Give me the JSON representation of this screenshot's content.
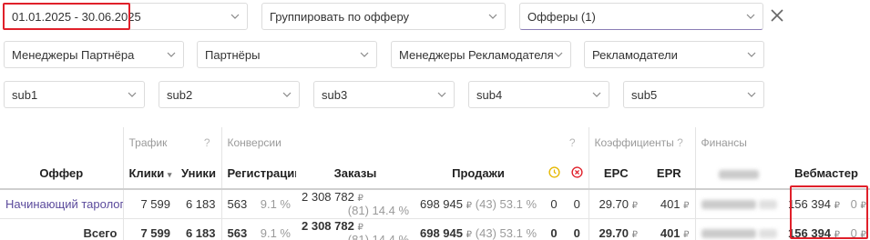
{
  "filters": {
    "date_range": "01.01.2025 - 30.06.2025",
    "group_by": "Группировать по офферу",
    "offers": "Офферы (1)",
    "partner_managers": "Менеджеры Партнёра",
    "partners": "Партнёры",
    "advertiser_managers": "Менеджеры Рекламодателя",
    "advertisers": "Рекламодатели",
    "sub1": "sub1",
    "sub2": "sub2",
    "sub3": "sub3",
    "sub4": "sub4",
    "sub5": "sub5"
  },
  "sections": {
    "traffic": "Трафик",
    "traffic_help": "?",
    "conversions": "Конверсии",
    "conversions_help": "?",
    "coefficients": "Коэффициенты",
    "coefficients_help": "?",
    "finances": "Финансы"
  },
  "columns": {
    "offer": "Оффер",
    "clicks": "Клики",
    "clicks_sort": "▾",
    "uniques": "Уники",
    "registrations": "Регистрации",
    "orders": "Заказы",
    "sales": "Продажи",
    "epc": "EPC",
    "epr": "EPR",
    "webmaster": "Вебмастер"
  },
  "rows": [
    {
      "offer": "Начинающий таролог",
      "clicks": "7 599",
      "uniques": "6 183",
      "registrations": "563",
      "reg_pct": "9.1 %",
      "orders_sum": "2 308 782",
      "orders_detail": "(81) 14.4 %",
      "sales_sum": "698 945",
      "sales_detail": "(43) 53.1 %",
      "pending": "0",
      "rejected": "0",
      "epc": "29.70",
      "epr": "401",
      "webmaster_sum": "156 394",
      "webmaster_extra": "0"
    }
  ],
  "total": {
    "label": "Всего",
    "clicks": "7 599",
    "uniques": "6 183",
    "registrations": "563",
    "reg_pct": "9.1 %",
    "orders_sum": "2 308 782",
    "orders_detail": "(81) 14.4 %",
    "sales_sum": "698 945",
    "sales_detail": "(43) 53.1 %",
    "pending": "0",
    "rejected": "0",
    "epc": "29.70",
    "epr": "401",
    "webmaster_sum": "156 394",
    "webmaster_extra": "0"
  },
  "currency_symbol": "₽",
  "icons": {
    "pending": "clock-icon",
    "rejected": "cancel-circle-icon",
    "chevron": "chevron-down-icon",
    "clear": "close-icon"
  },
  "colors": {
    "highlight": "#e0202a",
    "link": "#5b4a9c",
    "pending": "#e6b800",
    "rejected": "#e0202a"
  }
}
